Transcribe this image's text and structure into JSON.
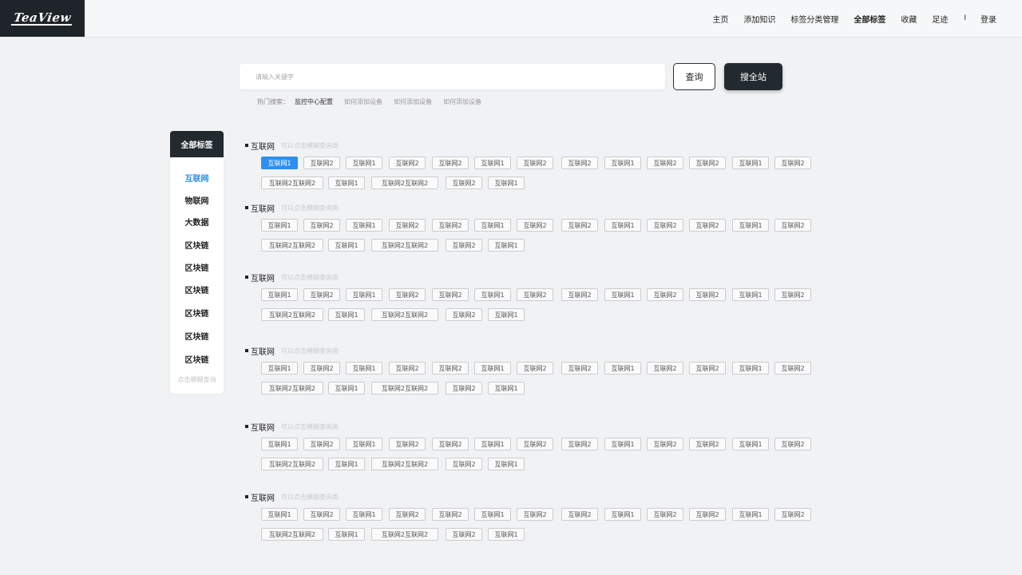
{
  "logo": "TeaView",
  "nav": {
    "items": [
      "主页",
      "添加知识",
      "标签分类管理",
      "全部标签",
      "收藏",
      "足迹"
    ],
    "active": "全部标签",
    "separator": "I",
    "login": "登录"
  },
  "search": {
    "placeholder": "请输入关键字",
    "query_label": "查询",
    "site_label": "搜全站",
    "hot_label": "热门搜索：",
    "hot_keywords": [
      "监控中心配置",
      "如何添加设备",
      "如何添加设备",
      "如何添加设备"
    ]
  },
  "sidebar": {
    "title": "全部标签",
    "items": [
      "互联网",
      "物联网",
      "大数据",
      "区块链",
      "区块链",
      "区块链",
      "区块链",
      "区块链",
      "区块链"
    ],
    "active_index": 0,
    "hint": "点击模糊查询"
  },
  "sections": [
    {
      "title": "互联网",
      "hint": "可以点击模糊查询类",
      "row1": [
        "互联网1",
        "互联网2",
        "互联网1",
        "互联网2",
        "互联网2",
        "互联网1",
        "互联网2",
        "互联网2",
        "互联网1",
        "互联网2",
        "互联网2",
        "互联网1",
        "互联网2"
      ],
      "row2": [
        "互联网2互联网2",
        "互联网1",
        "互联网2互联网2",
        "互联网2",
        "互联网1"
      ],
      "active_tag": 0
    },
    {
      "title": "互联网",
      "hint": "可以点击模糊查询类",
      "row1": [
        "互联网1",
        "互联网2",
        "互联网1",
        "互联网2",
        "互联网2",
        "互联网1",
        "互联网2",
        "互联网2",
        "互联网1",
        "互联网2",
        "互联网2",
        "互联网1",
        "互联网2"
      ],
      "row2": [
        "互联网2互联网2",
        "互联网1",
        "互联网2互联网2",
        "互联网2",
        "互联网1"
      ],
      "active_tag": -1
    },
    {
      "title": "互联网",
      "hint": "可以点击模糊查询类",
      "row1": [
        "互联网1",
        "互联网2",
        "互联网1",
        "互联网2",
        "互联网2",
        "互联网1",
        "互联网2",
        "互联网2",
        "互联网1",
        "互联网2",
        "互联网2",
        "互联网1",
        "互联网2"
      ],
      "row2": [
        "互联网2互联网2",
        "互联网1",
        "互联网2互联网2",
        "互联网2",
        "互联网1"
      ],
      "active_tag": -1
    },
    {
      "title": "互联网",
      "hint": "可以点击模糊查询类",
      "row1": [
        "互联网1",
        "互联网2",
        "互联网1",
        "互联网2",
        "互联网2",
        "互联网1",
        "互联网2",
        "互联网2",
        "互联网1",
        "互联网2",
        "互联网2",
        "互联网1",
        "互联网2"
      ],
      "row2": [
        "互联网2互联网2",
        "互联网1",
        "互联网2互联网2",
        "互联网2",
        "互联网1"
      ],
      "active_tag": -1
    },
    {
      "title": "互联网",
      "hint": "可以点击模糊查询类",
      "row1": [
        "互联网1",
        "互联网2",
        "互联网1",
        "互联网2",
        "互联网2",
        "互联网1",
        "互联网2",
        "互联网2",
        "互联网1",
        "互联网2",
        "互联网2",
        "互联网1",
        "互联网2"
      ],
      "row2": [
        "互联网2互联网2",
        "互联网1",
        "互联网2互联网2",
        "互联网2",
        "互联网1"
      ],
      "active_tag": -1
    },
    {
      "title": "互联网",
      "hint": "可以点击模糊查询类",
      "row1": [
        "互联网1",
        "互联网2",
        "互联网1",
        "互联网2",
        "互联网2",
        "互联网1",
        "互联网2",
        "互联网2",
        "互联网1",
        "互联网2",
        "互联网2",
        "互联网1",
        "互联网2"
      ],
      "row2": [
        "互联网2互联网2",
        "互联网1",
        "互联网2互联网2",
        "互联网2",
        "互联网1"
      ],
      "active_tag": -1
    }
  ]
}
